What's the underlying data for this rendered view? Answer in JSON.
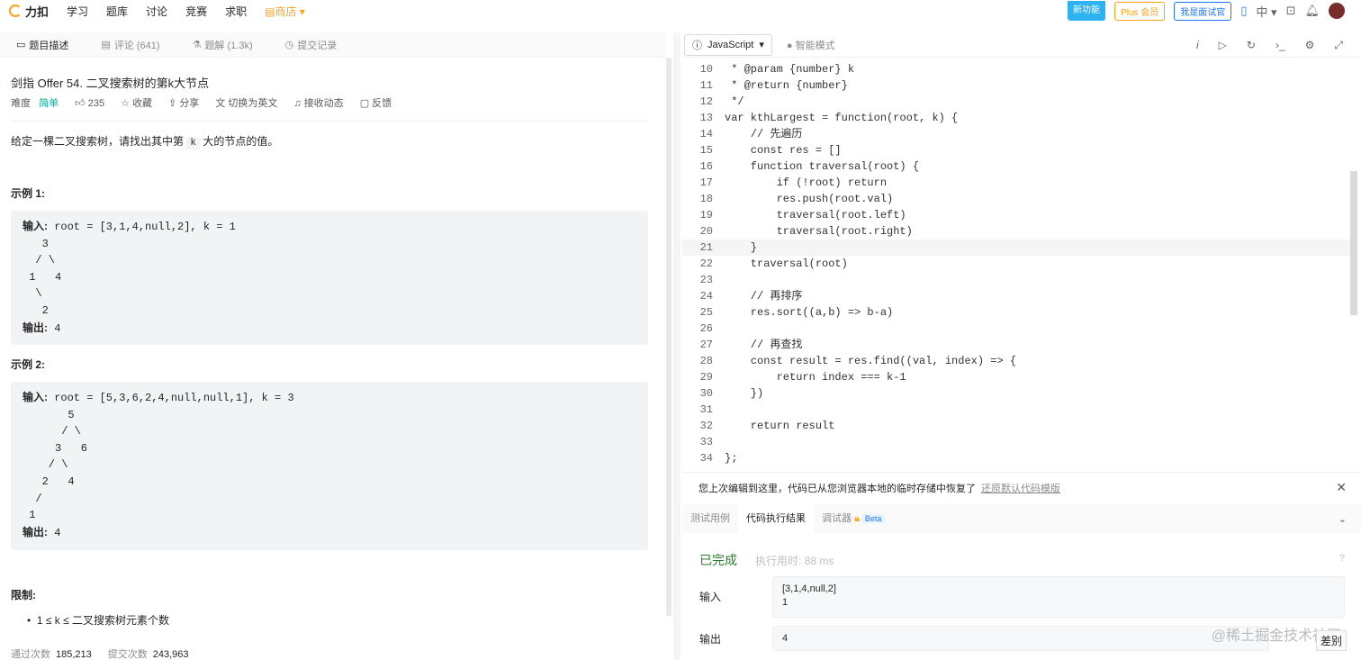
{
  "nav": {
    "logo": "力扣",
    "items": [
      "学习",
      "题库",
      "讨论",
      "竞赛",
      "求职"
    ],
    "shop": "商店",
    "new_feature": "新功能",
    "plus": "Plus 会员",
    "interviewer": "我是面试官",
    "lang": "中"
  },
  "left_tabs": [
    {
      "label": "题目描述",
      "icon": "description-icon"
    },
    {
      "label": "评论 (641)",
      "icon": "comment-icon"
    },
    {
      "label": "题解 (1.3k)",
      "icon": "flask-icon"
    },
    {
      "label": "提交记录",
      "icon": "history-icon"
    }
  ],
  "problem": {
    "title": "剑指 Offer 54. 二叉搜索树的第k大节点",
    "difficulty_label": "难度",
    "difficulty": "简单",
    "likes": "235",
    "collect": "收藏",
    "share": "分享",
    "switch_lang": "切换为英文",
    "subscribe": "接收动态",
    "feedback": "反馈",
    "desc_pre": "给定一棵二叉搜索树，请找出其中第",
    "desc_k": "k",
    "desc_post": "大的节点的值。",
    "example1_title": "示例 1:",
    "example1_input_label": "输入:",
    "example1_input": " root = [3,1,4,null,2], k = 1",
    "example1_tree": "   3\n  / \\\n 1   4\n  \\\n   2",
    "example1_output_label": "输出:",
    "example1_output": " 4",
    "example2_title": "示例 2:",
    "example2_input_label": "输入:",
    "example2_input": " root = [5,3,6,2,4,null,null,1], k = 3",
    "example2_tree": "       5\n      / \\\n     3   6\n    / \\\n   2   4\n  /\n 1",
    "example2_output_label": "输出:",
    "example2_output": " 4",
    "limits_title": "限制:",
    "limit_item": "1 ≤ k ≤ 二叉搜索树元素个数",
    "pass_label": "通过次数",
    "pass_count": "185,213",
    "submit_label": "提交次数",
    "submit_count": "243,963"
  },
  "editor": {
    "language": "JavaScript",
    "smart_mode": "智能模式",
    "lines": [
      {
        "n": "10",
        "t": " * @param {number} k"
      },
      {
        "n": "11",
        "t": " * @return {number}"
      },
      {
        "n": "12",
        "t": " */"
      },
      {
        "n": "13",
        "t": "var kthLargest = function(root, k) {"
      },
      {
        "n": "14",
        "t": "    // 先遍历"
      },
      {
        "n": "15",
        "t": "    const res = []"
      },
      {
        "n": "16",
        "t": "    function traversal(root) {"
      },
      {
        "n": "17",
        "t": "        if (!root) return"
      },
      {
        "n": "18",
        "t": "        res.push(root.val)"
      },
      {
        "n": "19",
        "t": "        traversal(root.left)"
      },
      {
        "n": "20",
        "t": "        traversal(root.right)"
      },
      {
        "n": "21",
        "t": "    }"
      },
      {
        "n": "22",
        "t": "    traversal(root)"
      },
      {
        "n": "23",
        "t": ""
      },
      {
        "n": "24",
        "t": "    // 再排序"
      },
      {
        "n": "25",
        "t": "    res.sort((a,b) => b-a)"
      },
      {
        "n": "26",
        "t": ""
      },
      {
        "n": "27",
        "t": "    // 再查找"
      },
      {
        "n": "28",
        "t": "    const result = res.find((val, index) => {"
      },
      {
        "n": "29",
        "t": "        return index === k-1"
      },
      {
        "n": "30",
        "t": "    })"
      },
      {
        "n": "31",
        "t": ""
      },
      {
        "n": "32",
        "t": "    return result"
      },
      {
        "n": "33",
        "t": ""
      },
      {
        "n": "34",
        "t": "};"
      }
    ]
  },
  "notice": {
    "text": "您上次编辑到这里，代码已从您浏览器本地的临时存储中恢复了",
    "link": "还原默认代码模版"
  },
  "result_tabs": [
    "测试用例",
    "代码执行结果",
    "调试器"
  ],
  "beta": "Beta",
  "result": {
    "status": "已完成",
    "exec_time": "执行用时: 88 ms",
    "input_label": "输入",
    "input_line1": "[3,1,4,null,2]",
    "input_line2": "1",
    "output_label": "输出",
    "output": "4",
    "diff": "差别"
  },
  "watermark": "@稀土掘金技术社区"
}
